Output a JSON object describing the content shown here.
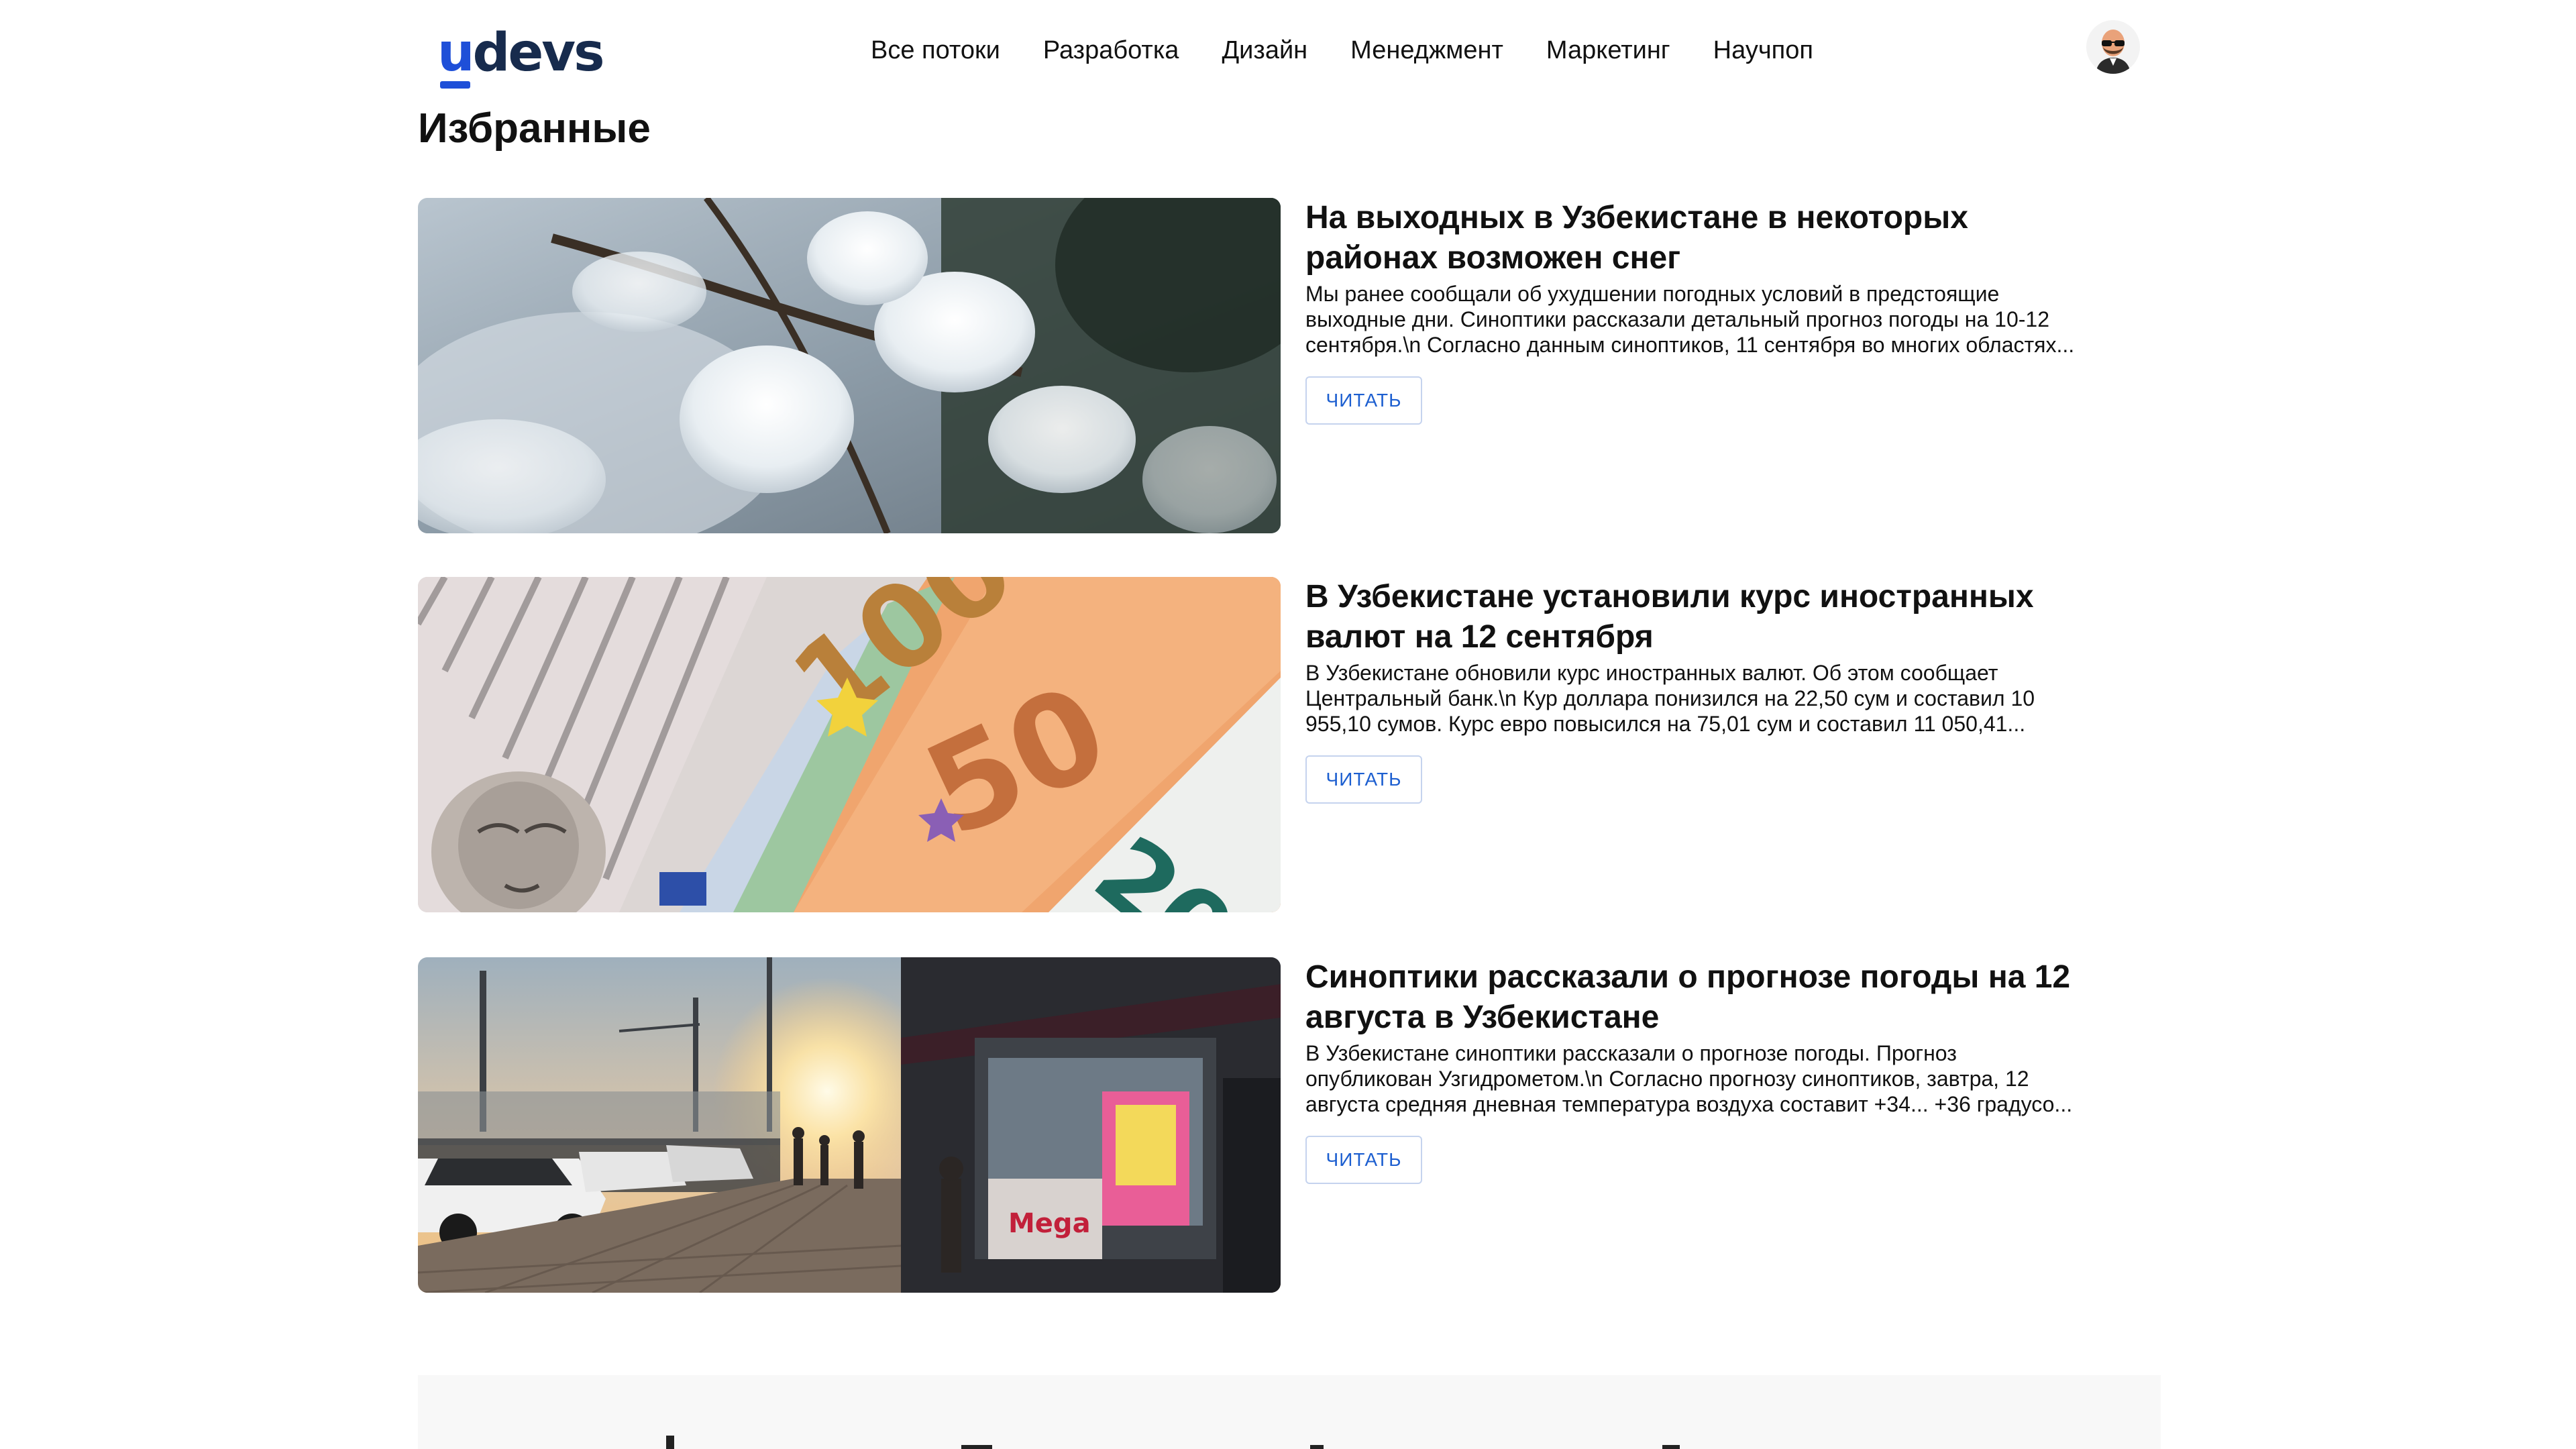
{
  "header": {
    "logo_prefix": "u",
    "logo_rest": "devs",
    "nav": [
      {
        "label": "Все потоки"
      },
      {
        "label": "Разработка"
      },
      {
        "label": "Дизайн"
      },
      {
        "label": "Менеджмент"
      },
      {
        "label": "Маркетинг"
      },
      {
        "label": "Научпоп"
      }
    ],
    "avatar_icon": "user-avatar"
  },
  "page": {
    "title": "Избранные"
  },
  "articles": [
    {
      "title": "На выходных в Узбекистане в некоторых районах возможен снег",
      "excerpt": "Мы ранее сообщали об ухудшении погодных условий в предстоящие выходные дни. Синоптики рассказали детальный прогноз погоды на 10-12 сентября.\\n Согласно данным синоптиков, 11 сентября во многих областях...",
      "button": "ЧИТАТЬ",
      "image": "snowy-pine-branches"
    },
    {
      "title": "В Узбекистане установили курс иностранных валют на 12 сентября",
      "excerpt": "В Узбекистане обновили курс иностранных валют. Об этом сообщает Центральный банк.\\n Кур доллара понизился на 22,50 сум и составил 10 955,10 сумов. Курс евро повысился на 75,01 сум и составил 11 050,41...",
      "button": "ЧИТАТЬ",
      "image": "dollar-and-euro-banknotes"
    },
    {
      "title": "Синоптики рассказали о прогнозе погоды на 12 августа в Узбекистане",
      "excerpt": "В Узбекистане синоптики рассказали о прогнозе погоды. Прогноз опубликован Узгидрометом.\\n Согласно прогнозу синоптиков, завтра, 12 августа средняя дневная температура воздуха составит +34... +36 градусо...",
      "button": "ЧИТАТЬ",
      "image": "street-at-sunset"
    }
  ],
  "colors": {
    "brand_blue": "#1e4fd8",
    "logo_dark": "#172b4d",
    "button_text": "#1d5fd0",
    "footer_bg": "#f8f8f8"
  }
}
